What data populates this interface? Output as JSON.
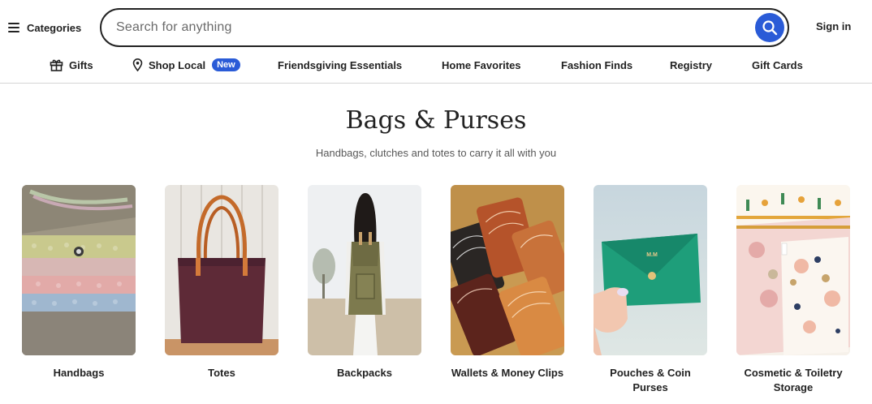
{
  "header": {
    "categories_label": "Categories",
    "search_placeholder": "Search for anything",
    "search_value": "",
    "signin_label": "Sign in"
  },
  "nav": {
    "items": [
      {
        "label": "Gifts",
        "icon": "gift-icon"
      },
      {
        "label": "Shop Local",
        "icon": "location-pin-icon",
        "badge": "New"
      },
      {
        "label": "Friendsgiving Essentials"
      },
      {
        "label": "Home Favorites"
      },
      {
        "label": "Fashion Finds"
      },
      {
        "label": "Registry"
      },
      {
        "label": "Gift Cards"
      }
    ]
  },
  "main": {
    "title": "Bags & Purses",
    "subtitle": "Handbags, clutches and totes to carry it all with you",
    "categories": [
      {
        "label": "Handbags"
      },
      {
        "label": "Totes"
      },
      {
        "label": "Backpacks"
      },
      {
        "label": "Wallets & Money Clips"
      },
      {
        "label": "Pouches & Coin Purses"
      },
      {
        "label": "Cosmetic & Toiletry Storage"
      }
    ]
  },
  "colors": {
    "accent": "#2a5bd7",
    "text": "#222222",
    "muted": "#595959",
    "divider": "#d6d6d6"
  }
}
